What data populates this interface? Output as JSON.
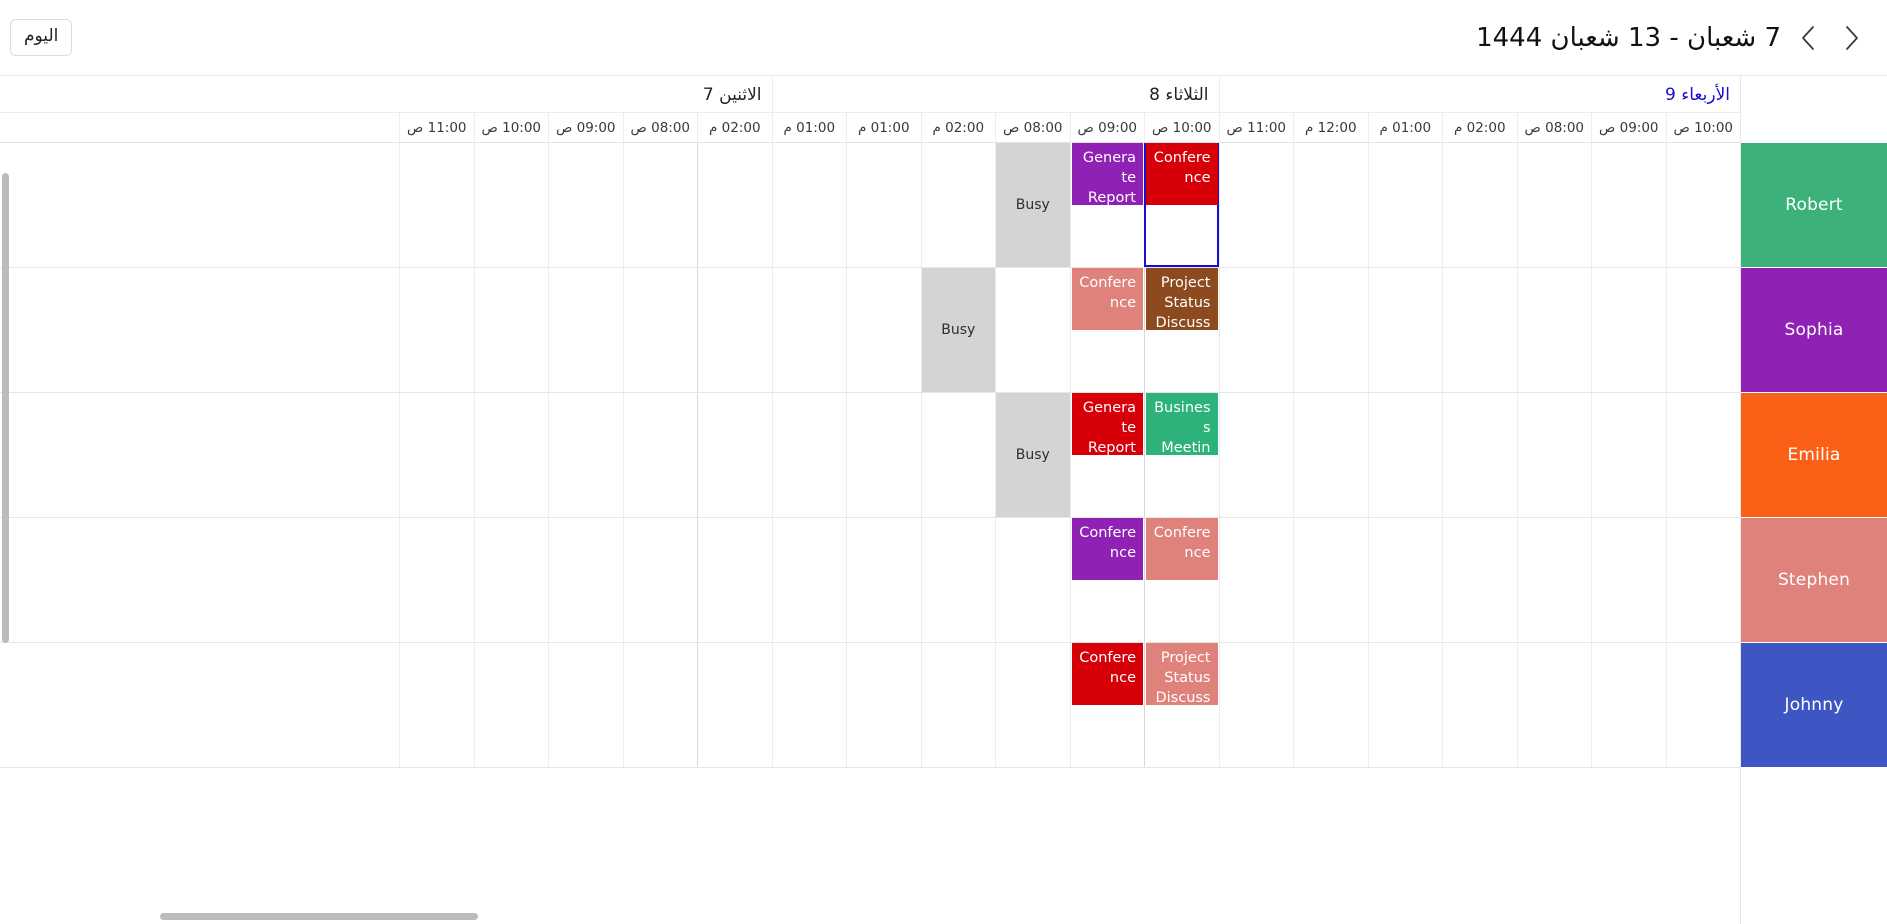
{
  "toolbar": {
    "today_label": "اليوم",
    "range_title": "7 شعبان - 13 شعبان 1444",
    "prev_icon": "chevron-right-icon",
    "next_icon": "chevron-left-icon"
  },
  "days": [
    {
      "label": "الأربعاء 9",
      "today": true,
      "span": 7
    },
    {
      "label": "الثلاثاء 8",
      "today": false,
      "span": 6
    },
    {
      "label": "الاثنين 7",
      "today": false,
      "span": 6
    }
  ],
  "time_slots": [
    "10:00 ص",
    "09:00 ص",
    "08:00 ص",
    "02:00 م",
    "01:00 م",
    "12:00 م",
    "11:00 ص",
    "10:00 ص",
    "09:00 ص",
    "08:00 ص",
    "02:00 م",
    "01:00 م",
    "01:00 م",
    "02:00 م",
    "08:00 ص",
    "09:00 ص",
    "10:00 ص",
    "11:00 ص"
  ],
  "resources": [
    {
      "name": "Robert",
      "color": "#3cb179"
    },
    {
      "name": "Sophia",
      "color": "#8f22b5"
    },
    {
      "name": "Emilia",
      "color": "#fb6017"
    },
    {
      "name": "Stephen",
      "color": "#e0827c"
    },
    {
      "name": "Johnny",
      "color": "#3e56c4"
    }
  ],
  "busy_label": "Busy",
  "colors": {
    "red": "#d70008",
    "purple": "#8f22b5",
    "brown": "#8c4a1e",
    "salmon": "#e0827c",
    "green": "#2db37a",
    "busy_grey": "#d4d4d4",
    "selection": "#1a0dcf",
    "today_text": "#1a0dcf"
  },
  "events": [
    {
      "row": 0,
      "col": 7,
      "title": "Conference",
      "color": "#d70008",
      "lines": 1
    },
    {
      "row": 0,
      "col": 8,
      "title": "Generate Report",
      "color": "#8f22b5",
      "lines": 1
    },
    {
      "row": 1,
      "col": 7,
      "title": "Project Status Discussion",
      "color": "#8c4a1e",
      "lines": 2
    },
    {
      "row": 1,
      "col": 8,
      "title": "Conference",
      "color": "#e0827c",
      "lines": 1
    },
    {
      "row": 2,
      "col": 7,
      "title": "Business Meeting",
      "color": "#2db37a",
      "lines": 1
    },
    {
      "row": 2,
      "col": 8,
      "title": "Generate Report",
      "color": "#d70008",
      "lines": 1
    },
    {
      "row": 3,
      "col": 7,
      "title": "Conference",
      "color": "#e0827c",
      "lines": 1
    },
    {
      "row": 3,
      "col": 8,
      "title": "Conference",
      "color": "#8f22b5",
      "lines": 1
    },
    {
      "row": 4,
      "col": 7,
      "title": "Project Status Discussion",
      "color": "#e0827c",
      "lines": 2
    },
    {
      "row": 4,
      "col": 8,
      "title": "Conference",
      "color": "#d70008",
      "lines": 1
    }
  ],
  "busy_cells": [
    {
      "row": 0,
      "col": 9
    },
    {
      "row": 1,
      "col": 10
    },
    {
      "row": 2,
      "col": 9
    }
  ],
  "selected_cell": {
    "row": 0,
    "col": 7
  }
}
